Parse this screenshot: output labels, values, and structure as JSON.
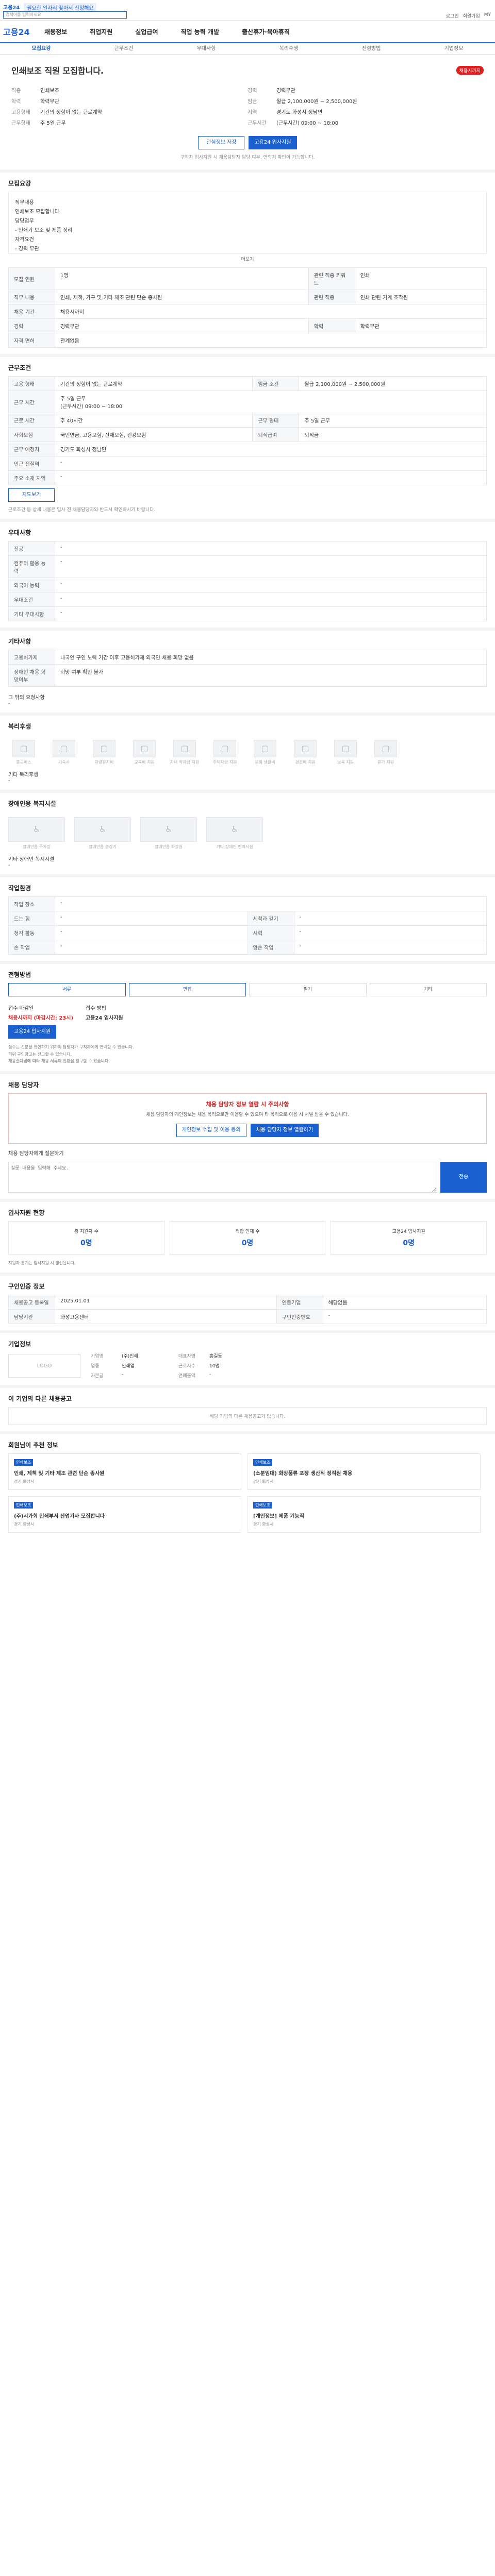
{
  "top": {
    "brand": "고용24",
    "notice": "필요한 일자리 찾아서 신청해요",
    "search_placeholder": "검색어를 입력하세요",
    "util": [
      "로그인",
      "회원가입",
      "MY"
    ]
  },
  "gnb": {
    "logo": "고용24",
    "menu": [
      "채용정보",
      "취업지원",
      "실업급여",
      "직업 능력 개발",
      "출산휴가·육아휴직"
    ]
  },
  "tabs": [
    "모집요강",
    "근무조건",
    "우대사항",
    "복리후생",
    "전형방법",
    "기업정보"
  ],
  "header": {
    "title": "인쇄보조 직원 모집합니다.",
    "badge": "채용시까지",
    "fields": [
      [
        "직종",
        "인쇄보조"
      ],
      [
        "경력",
        "경력무관"
      ],
      [
        "학력",
        "학력무관"
      ],
      [
        "임금",
        "월급 2,100,000원 ~ 2,500,000원"
      ],
      [
        "고용형태",
        "기간의 정함이 없는 근로계약"
      ],
      [
        "지역",
        "경기도 화성시 정남면"
      ],
      [
        "근무형태",
        "주 5일 근무"
      ],
      [
        "근무시간",
        "(근무시간) 09:00 ~ 18:00"
      ]
    ],
    "save": "관심정보 저장",
    "apply": "고용24 입사지원",
    "note": "구직자 입사지원 시 채용담당자 담당 여부, 연락처 확인이 가능합니다."
  },
  "recruit": {
    "title": "모집요강",
    "desc_label": "직무내용",
    "desc": "직무내용\n인쇄보조 모집합니다.\n담당업무\n- 인쇄기 보조 및 제품 정리\n자격요건\n- 경력 무관",
    "more": "더보기",
    "rows": [
      [
        "모집 인원",
        "1명",
        "관련 직종 키워드",
        "인쇄"
      ],
      [
        "직무 내용",
        "인쇄, 제책, 가구 및 기타 제조 관련 단순 종사원",
        "관련 직종",
        "인쇄 관련 기계 조작원"
      ],
      [
        "채용 기간",
        "채용시까지",
        "",
        ""
      ],
      [
        "경력",
        "경력무관",
        "학력",
        "학력무관"
      ],
      [
        "자격 면허",
        "관계없음",
        "",
        ""
      ]
    ]
  },
  "cond": {
    "title": "근무조건",
    "rows": [
      [
        "고용 형태",
        "기간의 정함이 없는 근로계약",
        "임금 조건",
        "월급 2,100,000원 ~ 2,500,000원"
      ],
      [
        "근무 시간",
        "주 5일 근무\n(근무시간) 09:00 ~ 18:00",
        "",
        ""
      ],
      [
        "근로 시간",
        "주 40시간",
        "근무 형태",
        "주 5일 근무"
      ],
      [
        "사회보험",
        "국민연금, 고용보험, 산재보험, 건강보험",
        "퇴직급여",
        "퇴직금"
      ],
      [
        "근무 예정지",
        "경기도 화성시 정남면",
        "",
        ""
      ],
      [
        "인근 전철역",
        "-",
        "",
        ""
      ],
      [
        "주요 소재 지역",
        "-",
        "",
        ""
      ]
    ],
    "map": "지도보기",
    "note": "근로조건 등 상세 내용은 입사 전 채용담당자와 반드시 확인하시기 바랍니다."
  },
  "pref": {
    "title": "우대사항",
    "rows": [
      [
        "전공",
        "-"
      ],
      [
        "컴퓨터 활용 능력",
        "-"
      ],
      [
        "외국어 능력",
        "-"
      ],
      [
        "우대조건",
        "-"
      ],
      [
        "기타 우대사항",
        "-"
      ]
    ]
  },
  "other": {
    "title": "기타사항",
    "rows": [
      [
        "고용허가제",
        "내국인 구인 노력 기간 이후 고용허가제 외국인 채용 희망 없음"
      ],
      [
        "장애인 채용 희망여부",
        "희망 여부 확인 불가"
      ]
    ],
    "sub": "그 밖의 요청사항",
    "subval": "-"
  },
  "welfare": {
    "title": "복리후생",
    "items": [
      "통근버스",
      "기숙사",
      "차량유지비",
      "교육비 지원",
      "자녀 학자금 지원",
      "주택자금 지원",
      "문화 생활비",
      "경조비 지원",
      "보육 지원",
      "휴가 지원"
    ],
    "sub": "기타 복리후생",
    "subval": "-"
  },
  "disab": {
    "title": "장애인용 복지시설",
    "items": [
      "장애인용 주차장",
      "장애인용 승강기",
      "장애인용 화장실",
      "기타 장애인 편의시설"
    ],
    "sub": "기타 장애인 복지시설",
    "subval": "-"
  },
  "work": {
    "title": "작업환경",
    "rows": [
      [
        "작업 장소",
        "-",
        "",
        ""
      ],
      [
        "드는 힘",
        "-",
        "세척과 걷기",
        "-"
      ],
      [
        "청각 활동",
        "-",
        "시력",
        "-"
      ],
      [
        "손 작업",
        "-",
        "양손 작업",
        "-"
      ]
    ]
  },
  "method": {
    "title": "전형방법",
    "steps": [
      "서류",
      "면접",
      "필기",
      "기타"
    ],
    "apply_label": "접수 마감일",
    "apply_val": "채용시까지 (마감시간: 23시)",
    "sub_label": "접수 방법",
    "sub_val": "고용24 입사지원",
    "btn": "고용24 입사지원",
    "bullets": [
      "접수는 신분을 확인하기 위하여 담당자가 구직자에게 연락할 수 있습니다.",
      "허위 구인광고는 신고할 수 있습니다.",
      "채용절차법에 따라 채용 서류의 반환을 청구할 수 있습니다."
    ]
  },
  "contact": {
    "title": "채용 담당자",
    "warn_title": "채용 담당자 정보 열람 시 주의사항",
    "warn": "채용 담당자의 개인정보는 채용 목적으로만 이용할 수 있으며 타 목적으로 이용 시 처벌 받을 수 있습니다.",
    "btn1": "개인정보 수집 및 이용 동의",
    "btn2": "채용 담당자 정보 열람하기",
    "q_label": "채용 담당자에게 질문하기",
    "q_ph": "질문 내용을 입력해 주세요.",
    "q_btn": "전송"
  },
  "stats": {
    "title": "입사지원 현황",
    "items": [
      [
        "총 지원자 수",
        "0명"
      ],
      [
        "적합 인재 수",
        "0명"
      ],
      [
        "고용24 입사지원",
        "0명"
      ]
    ],
    "note": "지원자 통계는 입사지원 시 갱신됩니다."
  },
  "info": {
    "title": "구인인증 정보",
    "rows": [
      [
        "채용공고 등록일",
        "2025.01.01",
        "인증기업",
        "해당없음"
      ],
      [
        "담당기관",
        "화성고용센터",
        "구인인증번호",
        "-"
      ]
    ]
  },
  "company": {
    "title": "기업정보",
    "logo": "LOGO",
    "fields": [
      [
        "기업명",
        "(주)인쇄",
        "대표자명",
        "홍길동"
      ],
      [
        "업종",
        "인쇄업",
        "근로자수",
        "10명"
      ],
      [
        "자본금",
        "-",
        "연매출액",
        "-"
      ]
    ]
  },
  "others": {
    "title": "이 기업의 다른 채용공고",
    "empty": "해당 기업의 다른 채용공고가 없습니다."
  },
  "rec": {
    "title": "회원님이 추천 정보",
    "cards": [
      [
        "인쇄보조",
        "인쇄, 제책 및 기타 제조 관련 단순 종사원",
        "경기 화성시"
      ],
      [
        "인쇄보조",
        "(소분임대) 화장품류 포장 생산직 정직원 채용",
        "경기 화성시"
      ],
      [
        "인쇄보조",
        "(주)시가회 인쇄부서 산업기사 모집합니다",
        "경기 화성시"
      ],
      [
        "인쇄보조",
        "[개인정보] 제품 기능직",
        "경기 화성시"
      ]
    ]
  }
}
